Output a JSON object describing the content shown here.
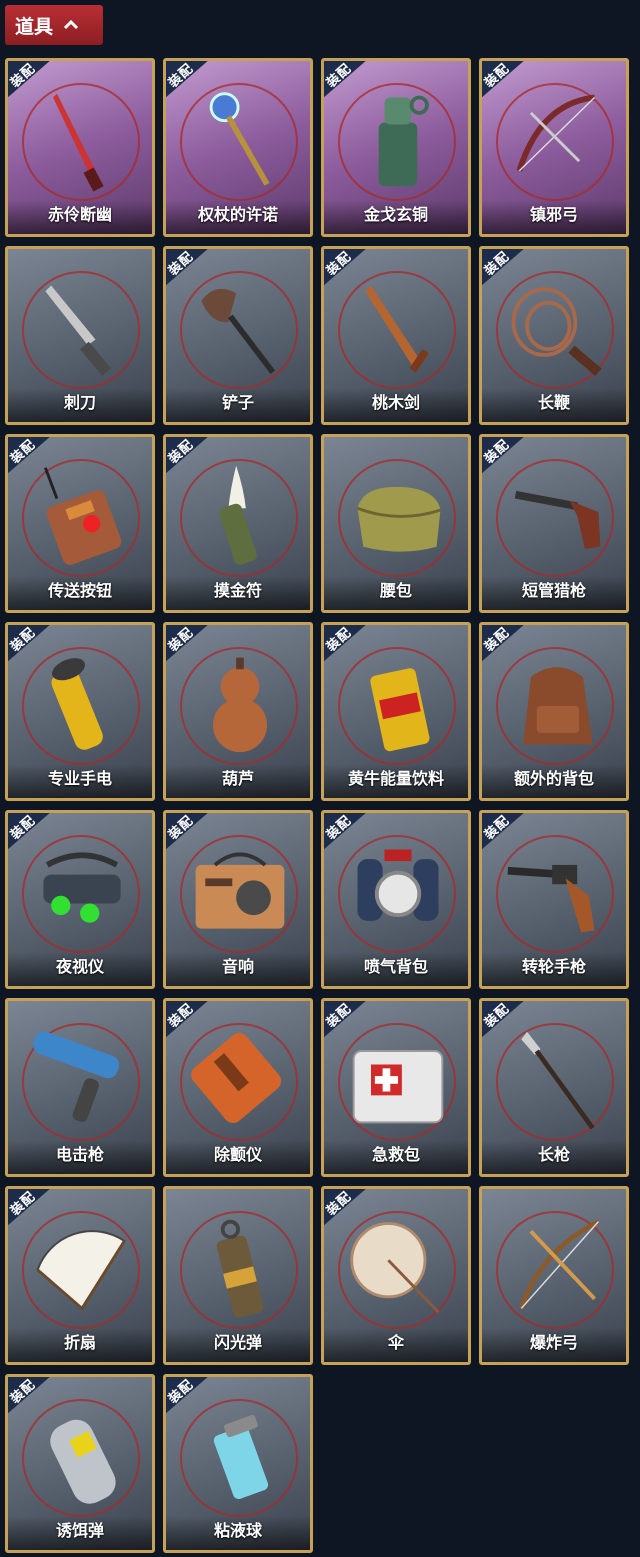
{
  "header": {
    "title": "道具",
    "icon": "chevron-up-icon"
  },
  "badge_label": "装配",
  "colors": {
    "background": "#0d1622",
    "header_red": "#b82f34",
    "card_border_gold": "#c7a256",
    "card_purple": "#8c5c9c",
    "card_gray": "#5b6572",
    "badge_blue": "#1d2c4a"
  },
  "items": [
    {
      "name": "赤伶断幽",
      "equipped": true,
      "rarity": "purple",
      "icon": "dagger-icon"
    },
    {
      "name": "权杖的许诺",
      "equipped": true,
      "rarity": "purple",
      "icon": "scepter-icon"
    },
    {
      "name": "金戈玄铜",
      "equipped": true,
      "rarity": "purple",
      "icon": "bronze-grenade-icon"
    },
    {
      "name": "镇邪弓",
      "equipped": true,
      "rarity": "purple",
      "icon": "bow-icon"
    },
    {
      "name": "刺刀",
      "equipped": false,
      "rarity": "gray",
      "icon": "bayonet-icon"
    },
    {
      "name": "铲子",
      "equipped": true,
      "rarity": "gray",
      "icon": "shovel-icon"
    },
    {
      "name": "桃木剑",
      "equipped": true,
      "rarity": "gray",
      "icon": "wooden-sword-icon"
    },
    {
      "name": "长鞭",
      "equipped": true,
      "rarity": "gray",
      "icon": "whip-icon"
    },
    {
      "name": "传送按钮",
      "equipped": true,
      "rarity": "gray",
      "icon": "teleport-button-icon"
    },
    {
      "name": "摸金符",
      "equipped": true,
      "rarity": "gray",
      "icon": "talisman-icon"
    },
    {
      "name": "腰包",
      "equipped": false,
      "rarity": "gray",
      "icon": "waist-bag-icon"
    },
    {
      "name": "短管猎枪",
      "equipped": true,
      "rarity": "gray",
      "icon": "shotgun-icon"
    },
    {
      "name": "专业手电",
      "equipped": true,
      "rarity": "gray",
      "icon": "flashlight-icon"
    },
    {
      "name": "葫芦",
      "equipped": true,
      "rarity": "gray",
      "icon": "gourd-icon"
    },
    {
      "name": "黄牛能量饮料",
      "equipped": true,
      "rarity": "gray",
      "icon": "energy-drink-icon"
    },
    {
      "name": "额外的背包",
      "equipped": true,
      "rarity": "gray",
      "icon": "backpack-icon"
    },
    {
      "name": "夜视仪",
      "equipped": true,
      "rarity": "gray",
      "icon": "night-vision-icon"
    },
    {
      "name": "音响",
      "equipped": true,
      "rarity": "gray",
      "icon": "speaker-icon"
    },
    {
      "name": "喷气背包",
      "equipped": true,
      "rarity": "gray",
      "icon": "jetpack-icon"
    },
    {
      "name": "转轮手枪",
      "equipped": true,
      "rarity": "gray",
      "icon": "revolver-icon"
    },
    {
      "name": "电击枪",
      "equipped": false,
      "rarity": "gray",
      "icon": "stun-gun-icon"
    },
    {
      "name": "除颤仪",
      "equipped": true,
      "rarity": "gray",
      "icon": "defibrillator-icon"
    },
    {
      "name": "急救包",
      "equipped": true,
      "rarity": "gray",
      "icon": "first-aid-kit-icon"
    },
    {
      "name": "长枪",
      "equipped": true,
      "rarity": "gray",
      "icon": "spear-icon"
    },
    {
      "name": "折扇",
      "equipped": true,
      "rarity": "gray",
      "icon": "folding-fan-icon"
    },
    {
      "name": "闪光弹",
      "equipped": false,
      "rarity": "gray",
      "icon": "flashbang-icon"
    },
    {
      "name": "伞",
      "equipped": true,
      "rarity": "gray",
      "icon": "umbrella-icon"
    },
    {
      "name": "爆炸弓",
      "equipped": false,
      "rarity": "gray",
      "icon": "explosive-bow-icon"
    },
    {
      "name": "诱饵弹",
      "equipped": true,
      "rarity": "gray",
      "icon": "decoy-grenade-icon"
    },
    {
      "name": "粘液球",
      "equipped": true,
      "rarity": "gray",
      "icon": "slime-ball-icon"
    }
  ]
}
